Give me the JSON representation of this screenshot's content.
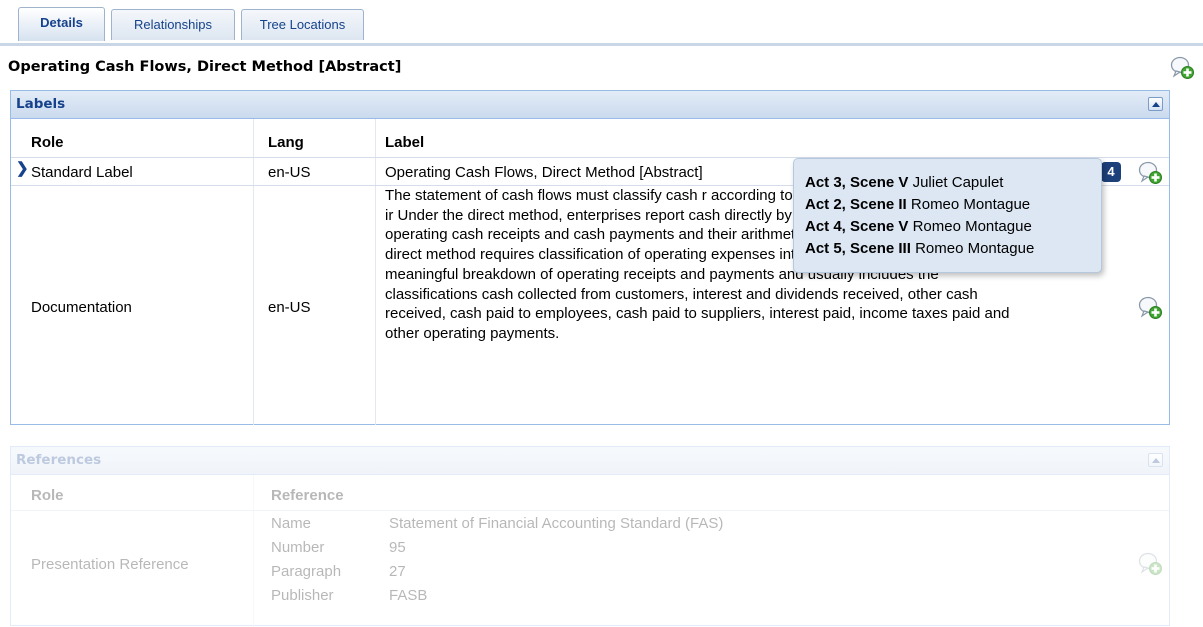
{
  "tabs": [
    {
      "label": "Details",
      "active": true
    },
    {
      "label": "Relationships",
      "active": false
    },
    {
      "label": "Tree Locations",
      "active": false
    }
  ],
  "concept_title": "Operating Cash Flows, Direct Method [Abstract]",
  "labels_panel": {
    "title": "Labels",
    "columns": {
      "role": "Role",
      "lang": "Lang",
      "label": "Label"
    },
    "rows": [
      {
        "role": "Standard Label",
        "lang": "en-US",
        "label": "Operating Cash Flows, Direct Method [Abstract]"
      },
      {
        "role": "Documentation",
        "lang": "en-US",
        "label": "The statement of cash flows must classify cash r according to whether they arise from operating, ir Under the direct method, enterprises report cash directly by showing major classes of operating cash receipts and cash payments and their arithmetic sum (the direct method). The direct method requires classification of operating expenses into classes that provide a meaningful breakdown of operating receipts and payments and usually includes the classifications cash collected from customers, interest and dividends received, other cash received, cash paid to employees, cash paid to suppliers, interest paid, income taxes paid and other operating payments."
      }
    ],
    "badge_count": "4"
  },
  "tooltip": {
    "entries": [
      {
        "act": "Act 3, Scene V",
        "name": "Juliet Capulet"
      },
      {
        "act": "Act 2, Scene II",
        "name": "Romeo Montague"
      },
      {
        "act": "Act 4, Scene V",
        "name": "Romeo Montague"
      },
      {
        "act": "Act 5, Scene III",
        "name": "Romeo Montague"
      }
    ]
  },
  "references_panel": {
    "title": "References",
    "columns": {
      "role": "Role",
      "reference": "Reference"
    },
    "rows": [
      {
        "role": "Presentation Reference",
        "fields": [
          {
            "key": "Name",
            "value": "Statement of Financial Accounting Standard (FAS)"
          },
          {
            "key": "Number",
            "value": "95"
          },
          {
            "key": "Paragraph",
            "value": "27"
          },
          {
            "key": "Publisher",
            "value": "FASB"
          }
        ]
      }
    ]
  },
  "colors": {
    "accent": "#15428b",
    "panel_border": "#99bbe8",
    "badge": "#1d3f7a",
    "add_icon_green": "#3fa531"
  },
  "icons": {
    "add": "comment-add-icon",
    "collapse": "chevron-up-icon",
    "row_marker": "chevron-right-icon"
  }
}
